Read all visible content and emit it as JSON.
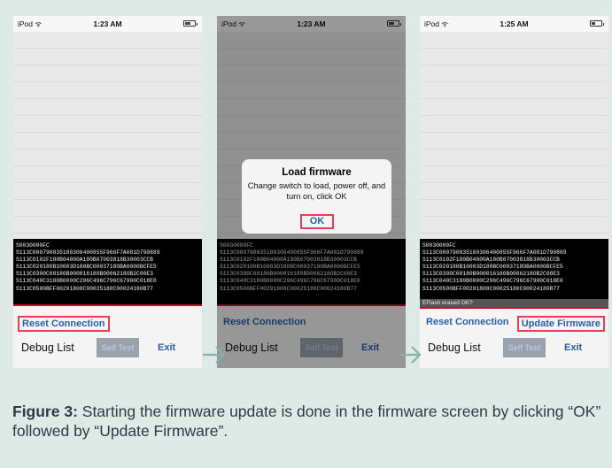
{
  "screens": [
    {
      "status": {
        "carrier": "iPod ᯤ",
        "time": "1:23 AM"
      },
      "console_lines": [
        "S0030000FC",
        "S113C000790835180306400855F966F7A081D790889",
        "S113C0102F180B04000A180B07003818B30003CCB",
        "S113C020180B10003D180BC0003718OBA0000BCFE5",
        "S113C0300C00180B000016180B0006218OB2C00E3",
        "S113C040C3180B0000C296C496C796C67900C018E0",
        "S113C0500BFF00291808C00025180C00024180B77"
      ],
      "reset_label": "Reset Connection",
      "debug_label": "Debug List",
      "selftest_label": "Self Test",
      "exit_label": "Exit"
    },
    {
      "status": {
        "carrier": "iPod ᯤ",
        "time": "1:23 AM"
      },
      "console_lines": [
        "S0030000FC",
        "S113C000790835180306400855F966F7A081D790889",
        "S113C0102F180B04000A180B07003818B30003CCB",
        "S113C020180B10003D180BC0003718OBA0000BCFE5",
        "S113C0300C00180B000016180B0006218OB2C00E3",
        "S113C040C3180B0000C296C496C796C67900C018E0",
        "S113C0500BFF00291808C00025180C00024180B77"
      ],
      "reset_label": "Reset Connection",
      "debug_label": "Debug List",
      "selftest_label": "Self Test",
      "exit_label": "Exit",
      "alert": {
        "title": "Load firmware",
        "message": "Change switch to load, power off, and turn on, click OK",
        "ok_label": "OK"
      }
    },
    {
      "status": {
        "carrier": "iPod ᯤ",
        "time": "1:25 AM"
      },
      "console_lines": [
        "S0030000FC",
        "S113C000790835180306400855F966F7A081D790889",
        "S113C0102F180B04000A180B07003818B30003CCB",
        "S113C020180B10003D180BC0003718OBA0000BCFE5",
        "S113C0300C00180B000016180B0006218OB2C00E3",
        "S113C040C3180B0000C296C496C796C67900C018E0",
        "S113C0500BFF00291808C00025180C00024180B77"
      ],
      "flash_message": "EFlash erased OK?",
      "reset_label": "Reset Connection",
      "update_label": "Update Firmware",
      "debug_label": "Debug List",
      "selftest_label": "Self Test",
      "exit_label": "Exit"
    }
  ],
  "caption": {
    "label": "Figure 3:",
    "text": " Starting the firmware update is done in the firmware screen by clicking “OK” followed by “Update Firmware”."
  },
  "colors": {
    "accent": "#2a5ea7",
    "highlight": "#e83e5c",
    "separator": "#c8102e",
    "arrow": "#7fb3ac"
  }
}
